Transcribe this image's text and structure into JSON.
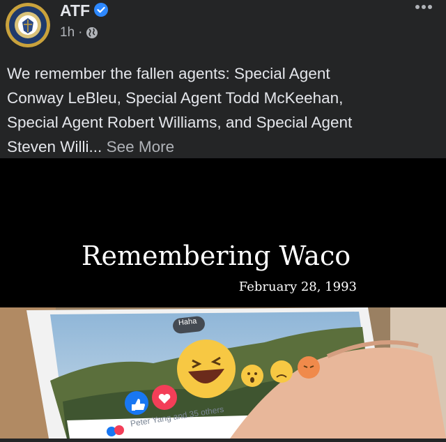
{
  "post": {
    "page_name": "ATF",
    "time": "1h",
    "separator": "·",
    "text_line_1": "We remember the fallen agents: Special Agent",
    "text_line_2": "Conway LeBleu, Special Agent Todd McKeehan,",
    "text_line_3": "Special Agent Robert Williams, and Special Agent",
    "text_line_4": "Steven Willi...",
    "see_more": "See More"
  },
  "banner": {
    "title": "Remembering Waco",
    "date": "February 28, 1993",
    "background": "#000000"
  },
  "photo": {
    "tooltip": "Haha",
    "likers": "Peter Yang and 35 others"
  },
  "icons": {
    "verified": "verified-badge-icon",
    "audience": "globe-icon",
    "menu": "more-options-icon"
  },
  "colors": {
    "background": "#242526",
    "text_primary": "#e4e6eb",
    "text_secondary": "#b0b3b8",
    "verified": "#2d88ff"
  }
}
